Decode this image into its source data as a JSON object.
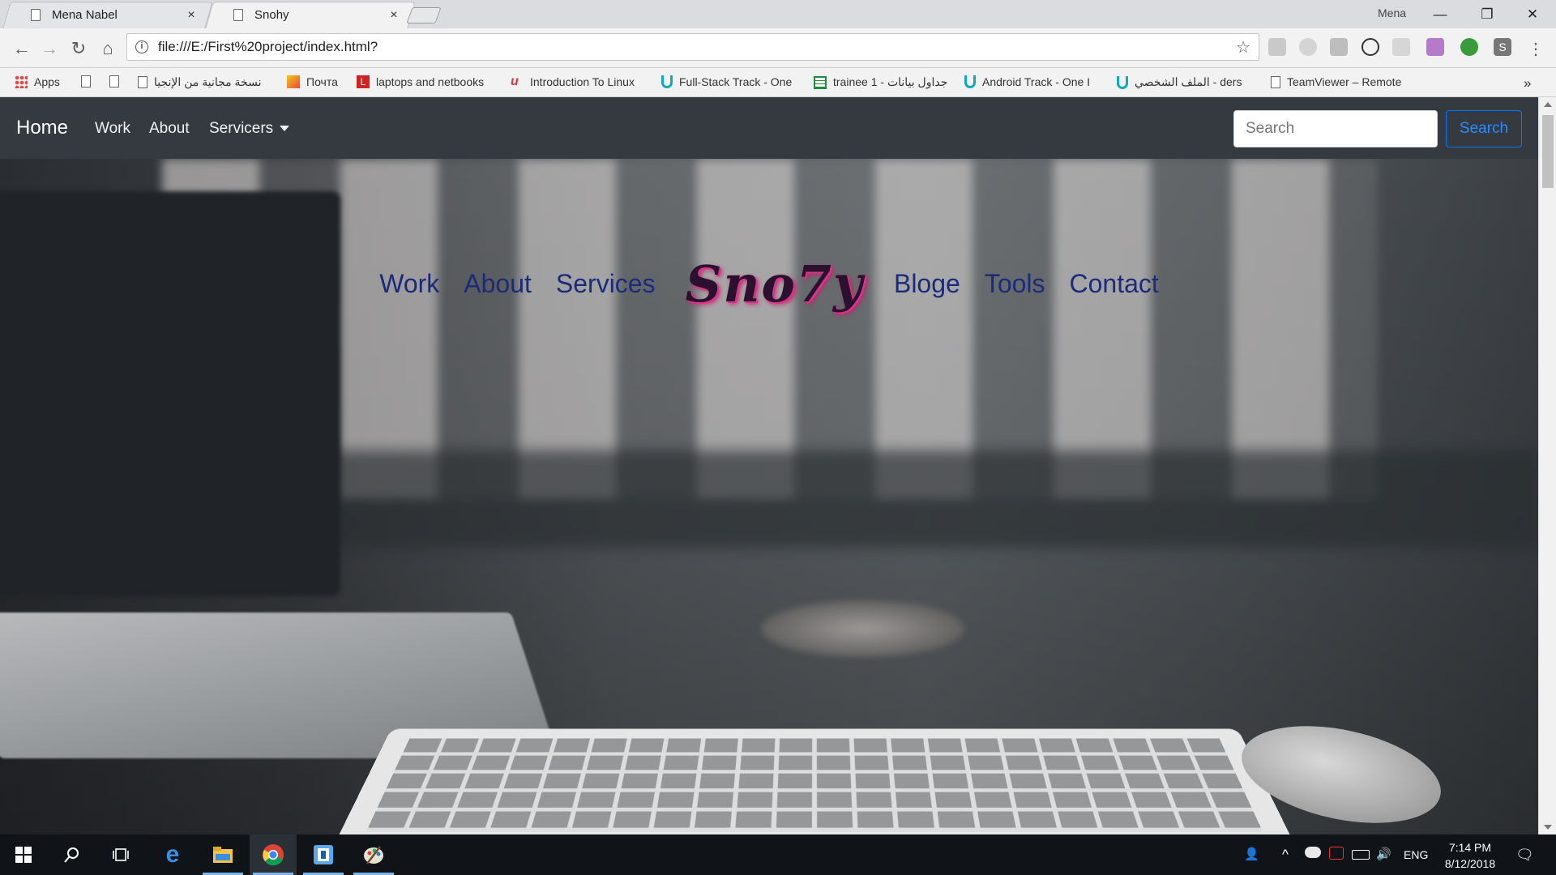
{
  "browser": {
    "tabs": [
      {
        "title": "Mena Nabel",
        "close": "×"
      },
      {
        "title": "Snohy",
        "close": "×"
      }
    ],
    "profile_name": "Mena",
    "window_controls": {
      "minimize": "—",
      "restore": "❐",
      "close": "✕"
    },
    "nav": {
      "back": "←",
      "forward": "→",
      "reload": "↻",
      "home": "⌂"
    },
    "address": "file:///E:/First%20project/index.html?",
    "address_info": "i",
    "bookmark_star": "☆",
    "menu": "⋮",
    "bookmarks": [
      {
        "label": "Apps",
        "icon": "apps-grid-icon"
      },
      {
        "label": "",
        "icon": "page-icon"
      },
      {
        "label": "",
        "icon": "page-icon"
      },
      {
        "label": "نسخة مجانية من الإنجيا",
        "icon": "page-icon"
      },
      {
        "label": "Почта",
        "icon": "mail-icon"
      },
      {
        "label": "laptops and netbooks",
        "icon": "l-logo-icon"
      },
      {
        "label": "Introduction To Linux",
        "icon": "udemy-icon"
      },
      {
        "label": "Full-Stack Track - One",
        "icon": "udacity-icon"
      },
      {
        "label": "trainee 1 - جداول بيانات",
        "icon": "sheets-icon"
      },
      {
        "label": "Android Track - One I",
        "icon": "udacity-icon"
      },
      {
        "label": "الملف الشخصي - ders",
        "icon": "udacity-icon"
      },
      {
        "label": "TeamViewer – Remote",
        "icon": "page-icon"
      }
    ],
    "bookmarks_overflow": "»"
  },
  "site": {
    "navbar": {
      "brand": "Home",
      "links": [
        "Work",
        "About"
      ],
      "dropdown": "Servicers",
      "search_placeholder": "Search",
      "search_button": "Search"
    },
    "hero": {
      "left_links": [
        "Work",
        "About",
        "Services"
      ],
      "logo": "Sno7y",
      "right_links": [
        "Bloge",
        "Tools",
        "Contact"
      ]
    }
  },
  "taskbar": {
    "items": [
      "start-icon",
      "search-icon",
      "task-view-icon",
      "edge-icon",
      "file-explorer-icon",
      "chrome-icon",
      "app-icon",
      "paint-icon"
    ],
    "tray": {
      "language": "ENG",
      "time": "7:14 PM",
      "date": "8/12/2018",
      "chevron": "^",
      "volume": "🔊",
      "people": "👤",
      "notifications": "🗨"
    }
  },
  "colors": {
    "navbar_bg": "#343a40",
    "search_outline": "#007bff",
    "hero_link": "#1c2a7a",
    "logo_shadow": "#e0308a",
    "taskbar_bg": "#101418"
  }
}
